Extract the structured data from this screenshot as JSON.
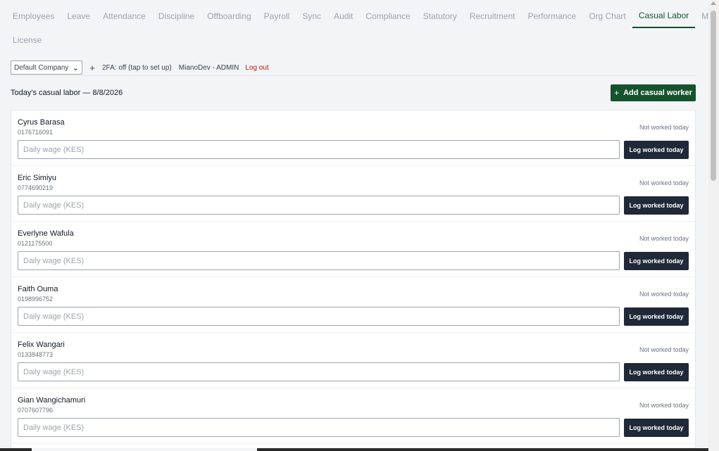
{
  "nav": {
    "row1": [
      {
        "label": "Employees"
      },
      {
        "label": "Leave"
      },
      {
        "label": "Attendance"
      },
      {
        "label": "Discipline"
      },
      {
        "label": "Offboarding"
      },
      {
        "label": "Payroll"
      },
      {
        "label": "Sync"
      },
      {
        "label": "Audit"
      },
      {
        "label": "Compliance"
      },
      {
        "label": "Statutory"
      },
      {
        "label": "Recruitment"
      },
      {
        "label": "Performance"
      },
      {
        "label": "Org Chart"
      },
      {
        "label": "Casual Labor",
        "active": true
      },
      {
        "label": "Migration"
      }
    ],
    "row2": [
      {
        "label": "License"
      }
    ]
  },
  "toolbar": {
    "company": "Default Company",
    "twofa": "2FA: off (tap to set up)",
    "user": "MianoDev - ADMIN",
    "logout": "Log out"
  },
  "header": {
    "title": "Today's casual labor — 8/8/2026",
    "add_plus": "+",
    "add_label": "Add casual worker"
  },
  "workers": [
    {
      "name": "Cyrus Barasa",
      "phone": "0176716091",
      "status": "Not worked today",
      "wage_placeholder": "Daily wage (KES)",
      "log_label": "Log worked today"
    },
    {
      "name": "Eric Simiyu",
      "phone": "0774690219",
      "status": "Not worked today",
      "wage_placeholder": "Daily wage (KES)",
      "log_label": "Log worked today"
    },
    {
      "name": "Everlyne Wafula",
      "phone": "0121175500",
      "status": "Not worked today",
      "wage_placeholder": "Daily wage (KES)",
      "log_label": "Log worked today"
    },
    {
      "name": "Faith Ouma",
      "phone": "0198996752",
      "status": "Not worked today",
      "wage_placeholder": "Daily wage (KES)",
      "log_label": "Log worked today"
    },
    {
      "name": "Felix Wangari",
      "phone": "0133848773",
      "status": "Not worked today",
      "wage_placeholder": "Daily wage (KES)",
      "log_label": "Log worked today"
    },
    {
      "name": "Gian Wangichamuri",
      "phone": "0707607796",
      "status": "Not worked today",
      "wage_placeholder": "Daily wage (KES)",
      "log_label": "Log worked today"
    }
  ],
  "colors": {
    "accent": "#14532d",
    "dark_button": "#1f2937",
    "logout": "#b91c1c"
  }
}
